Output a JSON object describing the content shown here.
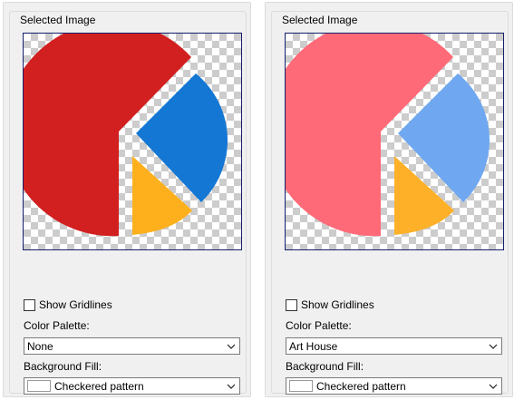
{
  "panels": [
    {
      "group_title": "Selected Image",
      "show_gridlines_label": "Show Gridlines",
      "show_gridlines_checked": false,
      "color_palette_label": "Color Palette:",
      "color_palette_value": "None",
      "background_fill_label": "Background Fill:",
      "background_fill_value": "Checkered pattern",
      "slice_colors": [
        "#d21f1f",
        "#1477d4",
        "#feb01c"
      ]
    },
    {
      "group_title": "Selected Image",
      "show_gridlines_label": "Show Gridlines",
      "show_gridlines_checked": false,
      "color_palette_label": "Color Palette:",
      "color_palette_value": "Art House",
      "background_fill_label": "Background Fill:",
      "background_fill_value": "Checkered pattern",
      "slice_colors": [
        "#ff6a78",
        "#6fa8f0",
        "#feb028"
      ]
    }
  ],
  "icons": {
    "dropdown": "chevron-down-icon"
  }
}
